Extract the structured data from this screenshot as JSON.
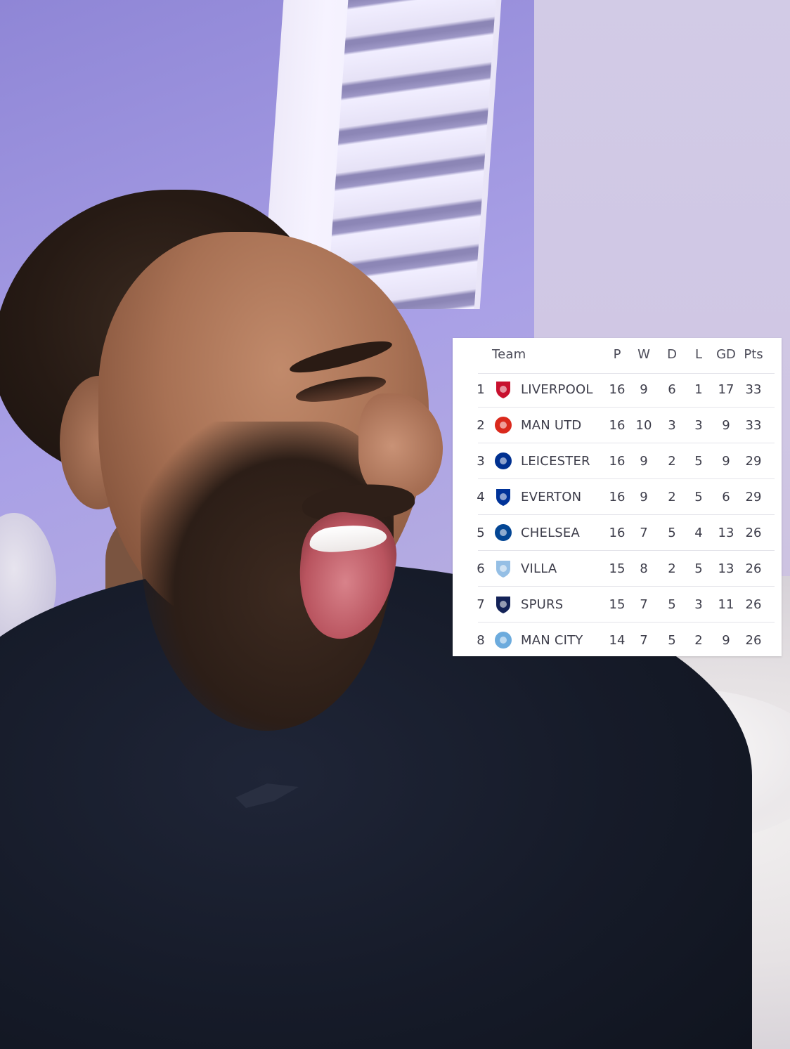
{
  "table": {
    "headers": {
      "team": "Team",
      "p": "P",
      "w": "W",
      "d": "D",
      "l": "L",
      "gd": "GD",
      "pts": "Pts"
    },
    "rows": [
      {
        "pos": "1",
        "team": "LIVERPOOL",
        "p": "16",
        "w": "9",
        "d": "6",
        "l": "1",
        "gd": "17",
        "pts": "33",
        "crest": "liverpool-crest-icon",
        "crest_color": "#c8102e"
      },
      {
        "pos": "2",
        "team": "MAN UTD",
        "p": "16",
        "w": "10",
        "d": "3",
        "l": "3",
        "gd": "9",
        "pts": "33",
        "crest": "man-utd-crest-icon",
        "crest_color": "#da291c"
      },
      {
        "pos": "3",
        "team": "LEICESTER",
        "p": "16",
        "w": "9",
        "d": "2",
        "l": "5",
        "gd": "9",
        "pts": "29",
        "crest": "leicester-crest-icon",
        "crest_color": "#003090"
      },
      {
        "pos": "4",
        "team": "EVERTON",
        "p": "16",
        "w": "9",
        "d": "2",
        "l": "5",
        "gd": "6",
        "pts": "29",
        "crest": "everton-crest-icon",
        "crest_color": "#003399"
      },
      {
        "pos": "5",
        "team": "CHELSEA",
        "p": "16",
        "w": "7",
        "d": "5",
        "l": "4",
        "gd": "13",
        "pts": "26",
        "crest": "chelsea-crest-icon",
        "crest_color": "#034694"
      },
      {
        "pos": "6",
        "team": "VILLA",
        "p": "15",
        "w": "8",
        "d": "2",
        "l": "5",
        "gd": "13",
        "pts": "26",
        "crest": "villa-crest-icon",
        "crest_color": "#95bfe5"
      },
      {
        "pos": "7",
        "team": "SPURS",
        "p": "15",
        "w": "7",
        "d": "5",
        "l": "3",
        "gd": "11",
        "pts": "26",
        "crest": "spurs-crest-icon",
        "crest_color": "#132257"
      },
      {
        "pos": "8",
        "team": "MAN CITY",
        "p": "14",
        "w": "7",
        "d": "5",
        "l": "2",
        "gd": "9",
        "pts": "26",
        "crest": "man-city-crest-icon",
        "crest_color": "#6cabdd"
      }
    ]
  }
}
